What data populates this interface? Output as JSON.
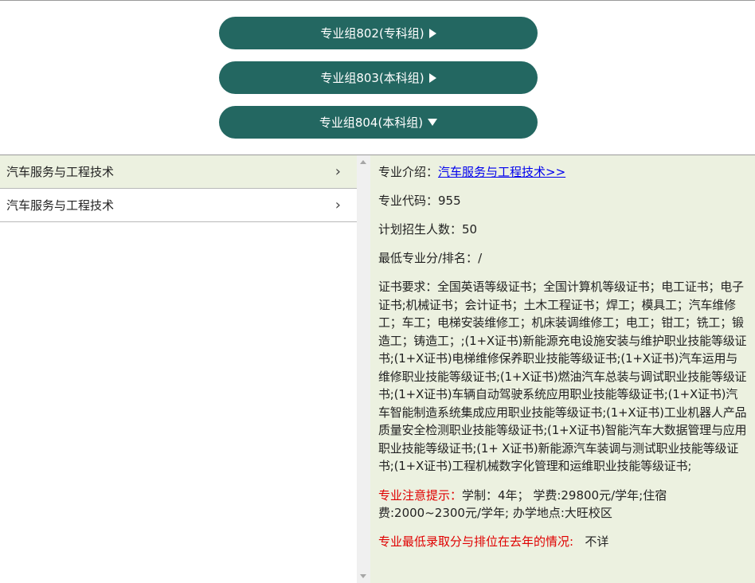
{
  "groups": [
    {
      "label": "专业组802(专科组)",
      "state": "collapsed"
    },
    {
      "label": "专业组803(本科组)",
      "state": "collapsed"
    },
    {
      "label": "专业组804(本科组)",
      "state": "expanded"
    }
  ],
  "majors": [
    {
      "label": "汽车服务与工程技术",
      "chevron": "›"
    },
    {
      "label": "汽车服务与工程技术",
      "chevron": "›"
    }
  ],
  "detail": {
    "intro_label": "专业介绍：",
    "intro_link": "汽车服务与工程技术>>",
    "code_label": "专业代码：",
    "code_value": "955",
    "plan_label": "计划招生人数：",
    "plan_value": "50",
    "min_label": "最低专业分/排名：",
    "min_value": "/",
    "cert_label": "证书要求：",
    "cert_value": "全国英语等级证书；全国计算机等级证书；电工证书；电子证书;机械证书；会计证书；土木工程证书；焊工；模具工；汽车维修工；车工；电梯安装维修工；机床装调维修工；电工；钳工；铣工；锻造工；铸造工；;(1+X证书)新能源充电设施安装与维护职业技能等级证书;(1+X证书)电梯维修保养职业技能等级证书;(1+X证书)汽车运用与维修职业技能等级证书;(1+X证书)燃油汽车总装与调试职业技能等级证书;(1+X证书)车辆自动驾驶系统应用职业技能等级证书;(1+X证书)汽车智能制造系统集成应用职业技能等级证书;(1+X证书)工业机器人产品质量安全检测职业技能等级证书;(1+X证书)智能汽车大数据管理与应用职业技能等级证书;(1+ X证书)新能源汽车装调与测试职业技能等级证书;(1+X证书)工程机械数字化管理和运维职业技能等级证书;",
    "note_label": "专业注意提示：",
    "note_value": "学制：4年；  学费:29800元/学年;住宿费:2000~2300元/学年; 办学地点:大旺校区",
    "history_label": "专业最低录取分与排位在去年的情况:",
    "history_value": "不详"
  },
  "colors": {
    "group_button": "#236761",
    "panel_background": "#ecf1e0",
    "highlight_text": "#e00000",
    "link": "#0000ee"
  }
}
